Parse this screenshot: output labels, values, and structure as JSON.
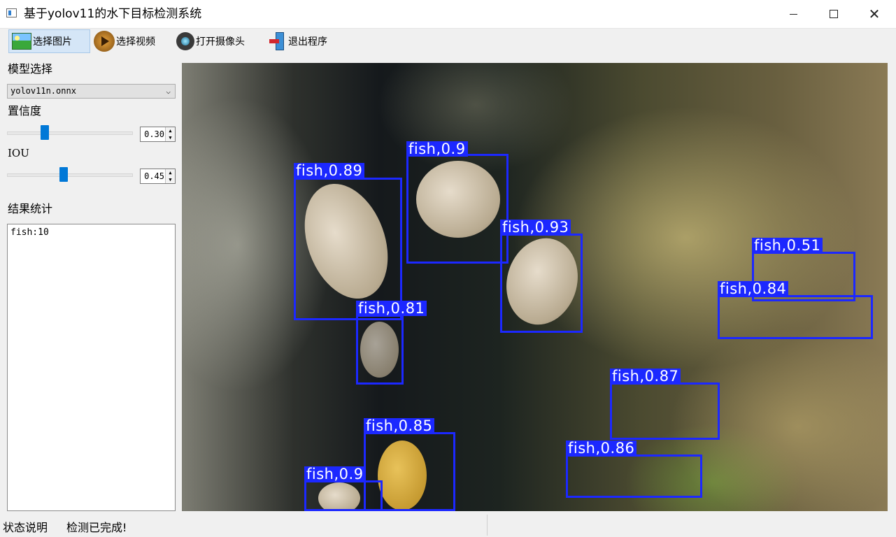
{
  "window": {
    "title": "基于yolov11的水下目标检测系统",
    "minimize_glyph": "",
    "close_glyph": "✕"
  },
  "toolbar": {
    "items": [
      {
        "label": "选择图片",
        "icon": "picture-icon",
        "active": true
      },
      {
        "label": "选择视频",
        "icon": "video-play-icon",
        "active": false
      },
      {
        "label": "打开摄像头",
        "icon": "webcam-icon",
        "active": false
      },
      {
        "label": "退出程序",
        "icon": "exit-door-icon",
        "active": false
      }
    ]
  },
  "left_panel": {
    "model_label": "模型选择",
    "model_value": "yolov11n.onnx",
    "confidence_label": "置信度",
    "confidence_value": "0.30",
    "confidence_fraction": 0.3,
    "iou_label": "IOU",
    "iou_value": "0.45",
    "iou_fraction": 0.45,
    "results_label": "结果统计",
    "results_text": "fish:10"
  },
  "detections": [
    {
      "label": "fish,0.89"
    },
    {
      "label": "fish,0.9"
    },
    {
      "label": "fish,0.93"
    },
    {
      "label": "fish,0.81"
    },
    {
      "label": "fish,0.51"
    },
    {
      "label": "fish,0.84"
    },
    {
      "label": "fish,0.87"
    },
    {
      "label": "fish,0.85"
    },
    {
      "label": "fish,0.86"
    },
    {
      "label": "fish,0.9"
    }
  ],
  "colors": {
    "detection_box": "#1c28ff",
    "slider_thumb": "#0078d7",
    "active_tool": "#d5e6f7"
  },
  "status": {
    "title": "状态说明",
    "message": "检测已完成!"
  }
}
